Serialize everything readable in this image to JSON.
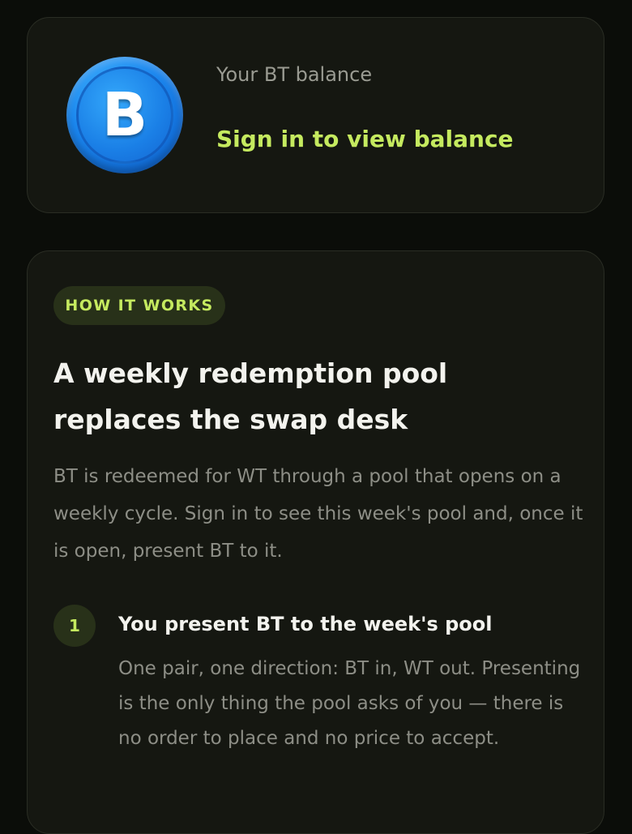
{
  "balance_card": {
    "token_symbol": "B",
    "token_icon": "bt-token-logo-icon",
    "label": "Your BT balance",
    "signin_link": "Sign in to view balance"
  },
  "info_card": {
    "badge": "HOW IT WORKS",
    "headline": "A weekly redemption pool replaces the swap desk",
    "description": "BT is redeemed for WT through a pool that opens on a weekly cycle. Sign in to see this week's pool and, once it is open, present BT to it.",
    "steps": [
      {
        "number": "1",
        "title": "You present BT to the week's pool",
        "body": "One pair, one direction: BT in, WT out. Presenting is the only thing the pool asks of you — there is no order to place and no price to accept."
      }
    ]
  },
  "colors": {
    "background": "#0b0d09",
    "card": "#151711",
    "accent": "#c5ea5f",
    "badge_bg": "#283119",
    "token_blue": "#1a86ee"
  }
}
